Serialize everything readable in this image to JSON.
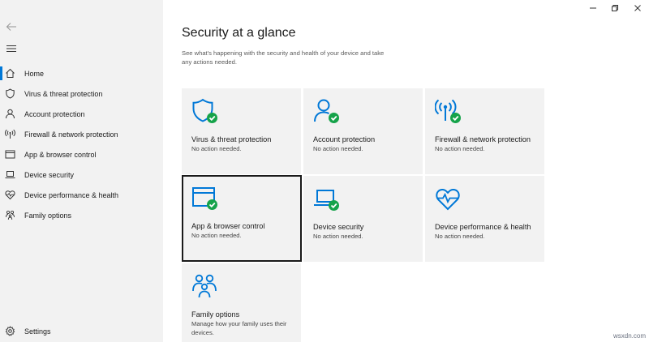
{
  "window": {
    "controls": [
      "minimize-icon",
      "restore-icon",
      "close-icon"
    ]
  },
  "colors": {
    "accent": "#0078d7",
    "ok": "#16a34a",
    "sidebar_bg": "#f2f2f2",
    "tile_bg": "#f2f2f2"
  },
  "sidebar": {
    "back_icon": "back-arrow-icon",
    "menu_icon": "hamburger-menu-icon",
    "items": [
      {
        "label": "Home",
        "icon": "home-icon",
        "active": true
      },
      {
        "label": "Virus & threat protection",
        "icon": "shield-icon",
        "active": false
      },
      {
        "label": "Account protection",
        "icon": "person-icon",
        "active": false
      },
      {
        "label": "Firewall & network protection",
        "icon": "wifi-antenna-icon",
        "active": false
      },
      {
        "label": "App & browser control",
        "icon": "app-window-icon",
        "active": false
      },
      {
        "label": "Device security",
        "icon": "laptop-icon",
        "active": false
      },
      {
        "label": "Device performance & health",
        "icon": "heart-pulse-icon",
        "active": false
      },
      {
        "label": "Family options",
        "icon": "family-icon",
        "active": false
      }
    ],
    "settings": {
      "label": "Settings",
      "icon": "gear-icon"
    }
  },
  "main": {
    "title": "Security at a glance",
    "description": "See what's happening with the security and health of your device and take any actions needed.",
    "tiles": [
      {
        "title": "Virus & threat protection",
        "status": "No action needed.",
        "icon": "shield-check-icon"
      },
      {
        "title": "Account protection",
        "status": "No action needed.",
        "icon": "person-check-icon"
      },
      {
        "title": "Firewall & network protection",
        "status": "No action needed.",
        "icon": "antenna-check-icon"
      },
      {
        "title": "App & browser control",
        "status": "No action needed.",
        "icon": "window-check-icon",
        "selected": true
      },
      {
        "title": "Device security",
        "status": "No action needed.",
        "icon": "laptop-check-icon"
      },
      {
        "title": "Device performance & health",
        "status": "No action needed.",
        "icon": "heart-pulse-icon"
      },
      {
        "title": "Family options",
        "status": "Manage how your family uses their devices.",
        "icon": "family-icon"
      }
    ]
  },
  "watermark": "wsxdn.com"
}
